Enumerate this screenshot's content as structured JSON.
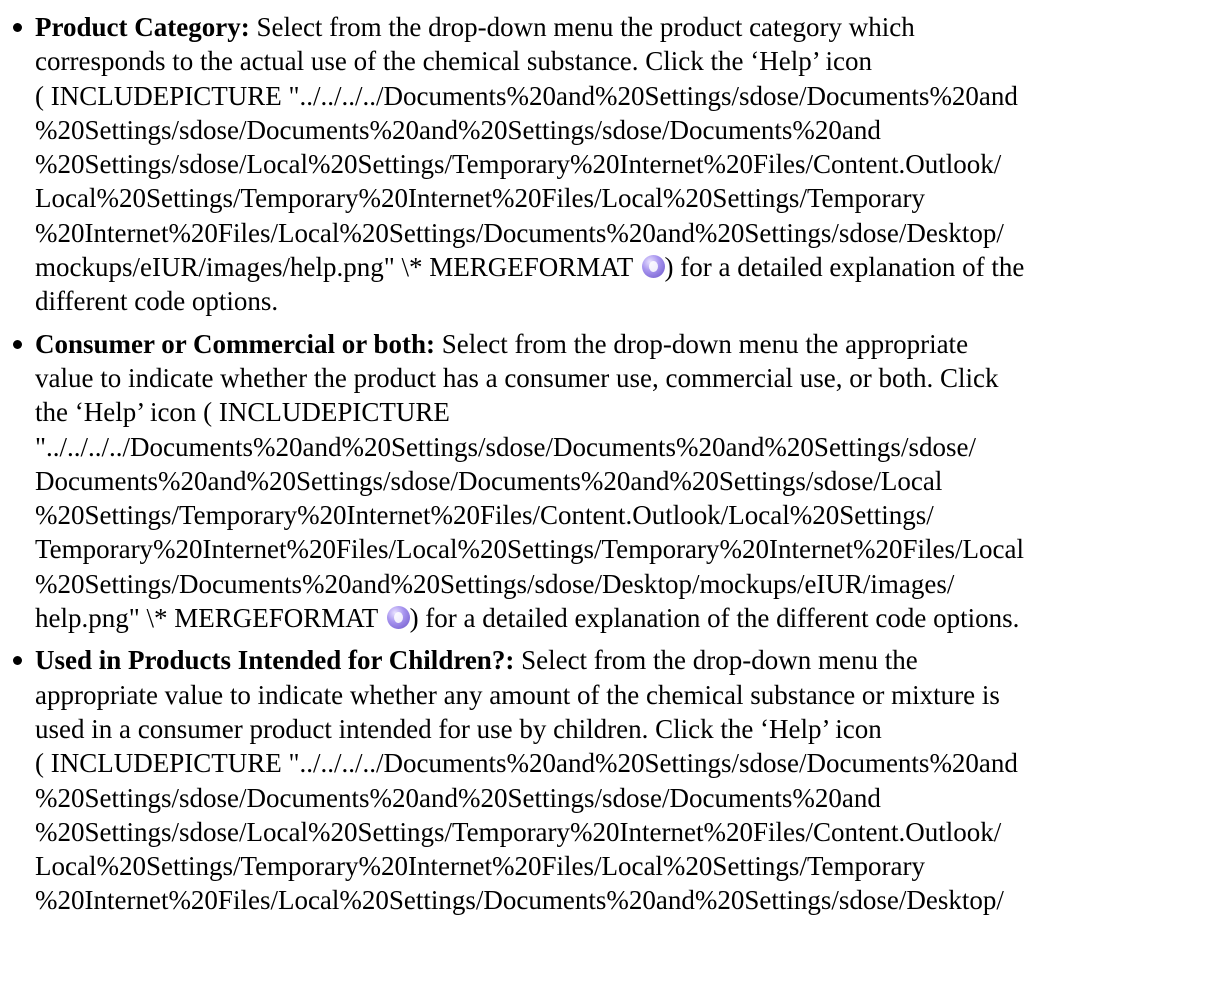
{
  "items": [
    {
      "term": "Product Category:",
      "lines": [
        " Select from the drop-down menu the product category which",
        "corresponds to the actual use of the chemical substance. Click the ‘Help’ icon",
        "( INCLUDEPICTURE \"../../../../Documents%20and%20Settings/sdose/Documents%20and",
        "%20Settings/sdose/Documents%20and%20Settings/sdose/Documents%20and",
        "%20Settings/sdose/Local%20Settings/Temporary%20Internet%20Files/Content.Outlook/",
        "Local%20Settings/Temporary%20Internet%20Files/Local%20Settings/Temporary",
        "%20Internet%20Files/Local%20Settings/Documents%20and%20Settings/sdose/Desktop/"
      ],
      "icon_line_prefix": "mockups/eIUR/images/help.png\" \\* MERGEFORMAT ",
      "icon_line_suffix": ") for a detailed explanation of the",
      "after_lines": [
        "different code options."
      ]
    },
    {
      "term": "Consumer or Commercial or both:",
      "lines": [
        " Select from the drop-down menu the appropriate",
        "value to indicate whether the product has a consumer use, commercial use, or both. Click",
        "the ‘Help’ icon ( INCLUDEPICTURE",
        "\"../../../../Documents%20and%20Settings/sdose/Documents%20and%20Settings/sdose/",
        "Documents%20and%20Settings/sdose/Documents%20and%20Settings/sdose/Local",
        "%20Settings/Temporary%20Internet%20Files/Content.Outlook/Local%20Settings/",
        "Temporary%20Internet%20Files/Local%20Settings/Temporary%20Internet%20Files/Local",
        "%20Settings/Documents%20and%20Settings/sdose/Desktop/mockups/eIUR/images/"
      ],
      "icon_line_prefix": "help.png\" \\* MERGEFORMAT ",
      "icon_line_suffix": ") for a detailed explanation of the different code options.",
      "after_lines": []
    },
    {
      "term": "Used in Products Intended for Children?:",
      "lines": [
        " Select from the drop-down menu the",
        "appropriate value to indicate whether any amount of the chemical substance or mixture is",
        "used in a consumer product intended for use by children. Click the ‘Help’ icon",
        "( INCLUDEPICTURE \"../../../../Documents%20and%20Settings/sdose/Documents%20and",
        "%20Settings/sdose/Documents%20and%20Settings/sdose/Documents%20and",
        "%20Settings/sdose/Local%20Settings/Temporary%20Internet%20Files/Content.Outlook/",
        "Local%20Settings/Temporary%20Internet%20Files/Local%20Settings/Temporary",
        "%20Internet%20Files/Local%20Settings/Documents%20and%20Settings/sdose/Desktop/"
      ],
      "icon_line_prefix": "",
      "icon_line_suffix": "",
      "after_lines": []
    }
  ]
}
